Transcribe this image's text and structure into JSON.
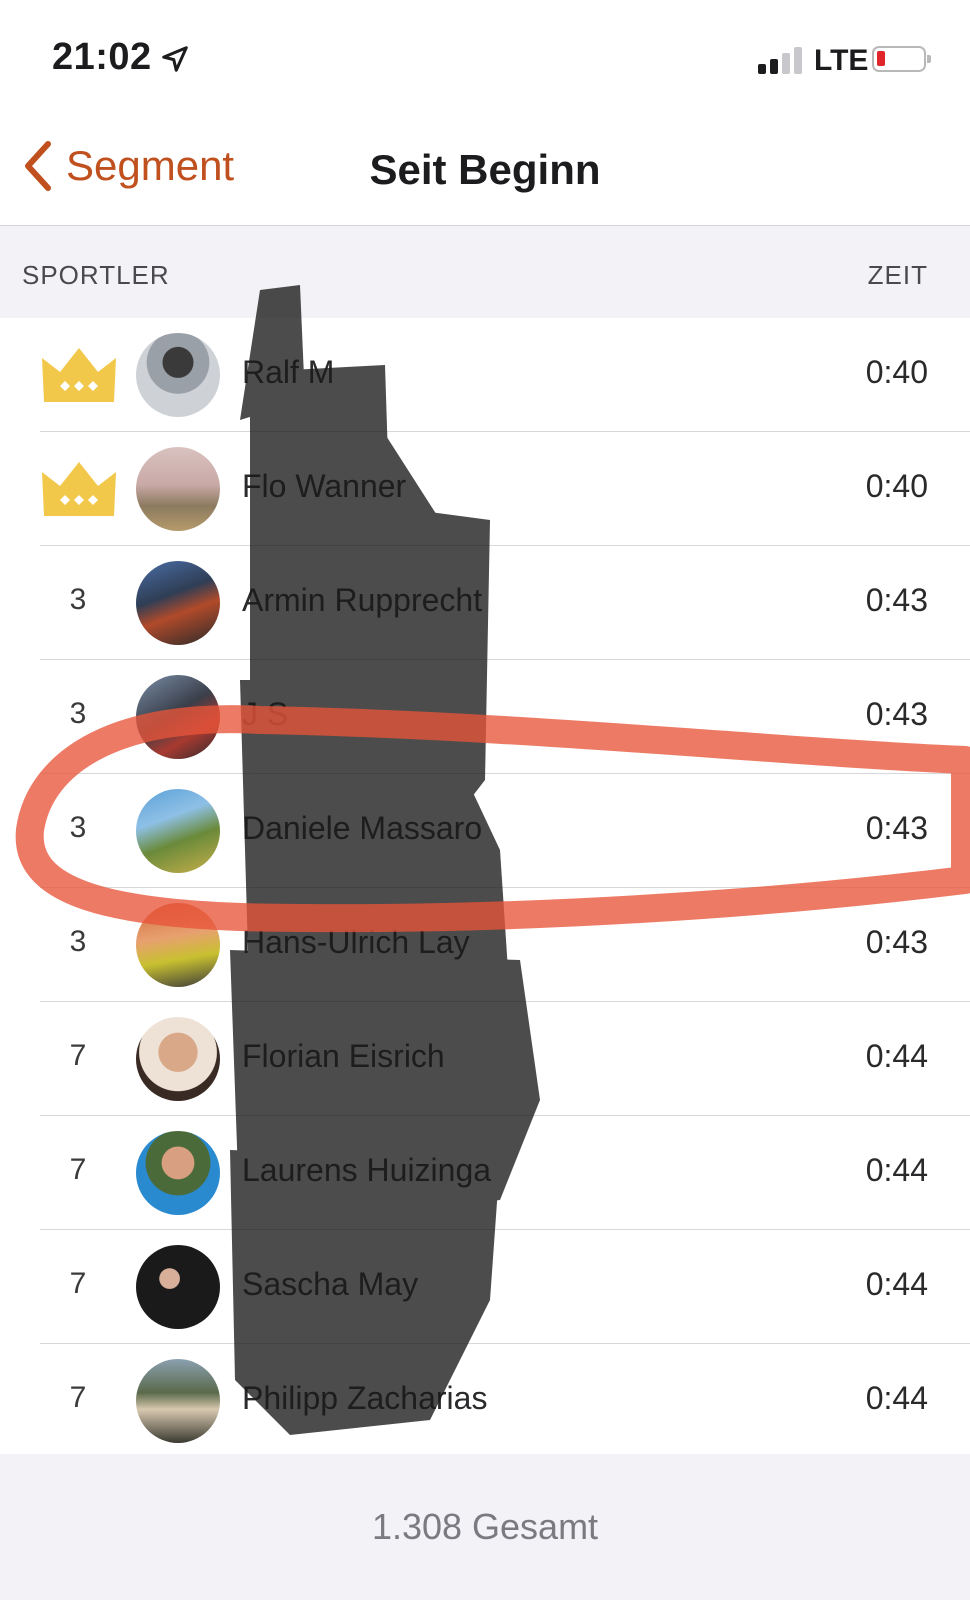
{
  "status_bar": {
    "time": "21:02",
    "network": "LTE",
    "icons": [
      "location-arrow-icon",
      "cellular-signal-icon",
      "battery-icon"
    ],
    "battery_color": "#e0262a"
  },
  "nav": {
    "back_label": "Segment",
    "title": "Seit Beginn",
    "accent_color": "#c0501e"
  },
  "table": {
    "col_athlete": "SPORTLER",
    "col_time": "ZEIT",
    "rows": [
      {
        "rank": "",
        "crown": true,
        "name": "Ralf M",
        "time": "0:40"
      },
      {
        "rank": "",
        "crown": true,
        "name": "Flo Wanner",
        "time": "0:40"
      },
      {
        "rank": "3",
        "crown": false,
        "name": "Armin Rupprecht",
        "time": "0:43"
      },
      {
        "rank": "3",
        "crown": false,
        "name": "J S",
        "time": "0:43"
      },
      {
        "rank": "3",
        "crown": false,
        "name": "Daniele Massaro",
        "time": "0:43"
      },
      {
        "rank": "3",
        "crown": false,
        "name": "Hans-Ulrich Lay",
        "time": "0:43"
      },
      {
        "rank": "7",
        "crown": false,
        "name": "Florian Eisrich",
        "time": "0:44"
      },
      {
        "rank": "7",
        "crown": false,
        "name": "Laurens Huizinga",
        "time": "0:44"
      },
      {
        "rank": "7",
        "crown": false,
        "name": "Sascha May",
        "time": "0:44"
      },
      {
        "rank": "7",
        "crown": false,
        "name": "Philipp Zacharias",
        "time": "0:44"
      }
    ]
  },
  "footer": {
    "total": "1.308 Gesamt"
  },
  "colors": {
    "crown": "#f2c84b",
    "highlight_ellipse": "#e8553a",
    "redaction": "#1a1a1a"
  }
}
